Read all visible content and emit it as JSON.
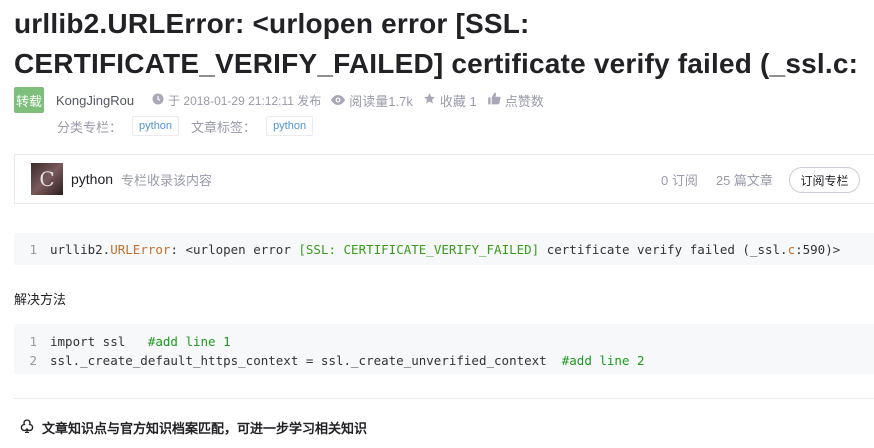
{
  "article": {
    "title": "urllib2.URLError: <urlopen error [SSL: CERTIFICATE_VERIFY_FAILED] certificate verify failed (_ssl.c:",
    "badge": "转载",
    "author": "KongJingRou",
    "published": "于 2018-01-29 21:12:11 发布",
    "views": "阅读量1.7k",
    "favorites": "收藏 1",
    "likes": "点赞数",
    "category_label": "分类专栏：",
    "category_tag": "python",
    "article_tags_label": "文章标签：",
    "article_tag": "python"
  },
  "column": {
    "avatar_letter": "C",
    "name": "python",
    "desc": "专栏收录该内容",
    "subscribers": "0 订阅",
    "articles": "25 篇文章",
    "subscribe_button": "订阅专栏"
  },
  "code_block_1": {
    "lines": [
      {
        "num": "1",
        "segments": [
          {
            "text": "urllib2.",
            "style": "default"
          },
          {
            "text": "URLError",
            "style": "orange"
          },
          {
            "text": ": <urlopen error ",
            "style": "default"
          },
          {
            "text": "[SSL: CERTIFICATE_VERIFY_FAILED]",
            "style": "green"
          },
          {
            "text": " certificate verify failed (_ssl.",
            "style": "default"
          },
          {
            "text": "c",
            "style": "orange"
          },
          {
            "text": ":590)>",
            "style": "default"
          }
        ]
      }
    ]
  },
  "section_heading": "解决方法",
  "code_block_2": {
    "lines": [
      {
        "num": "1",
        "segments": [
          {
            "text": "import ssl   ",
            "style": "default"
          },
          {
            "text": "#add line 1",
            "style": "comment"
          }
        ]
      },
      {
        "num": "2",
        "segments": [
          {
            "text": "ssl._create_default_https_context = ssl._create_unverified_context  ",
            "style": "default"
          },
          {
            "text": "#add line 2",
            "style": "comment"
          }
        ]
      }
    ]
  },
  "knowledge_text": "文章知识点与官方知识档案匹配，可进一步学习相关知识",
  "icons": [
    "clock-icon",
    "eye-icon",
    "star-icon",
    "thumbs-up-icon",
    "knowledge-icon"
  ]
}
